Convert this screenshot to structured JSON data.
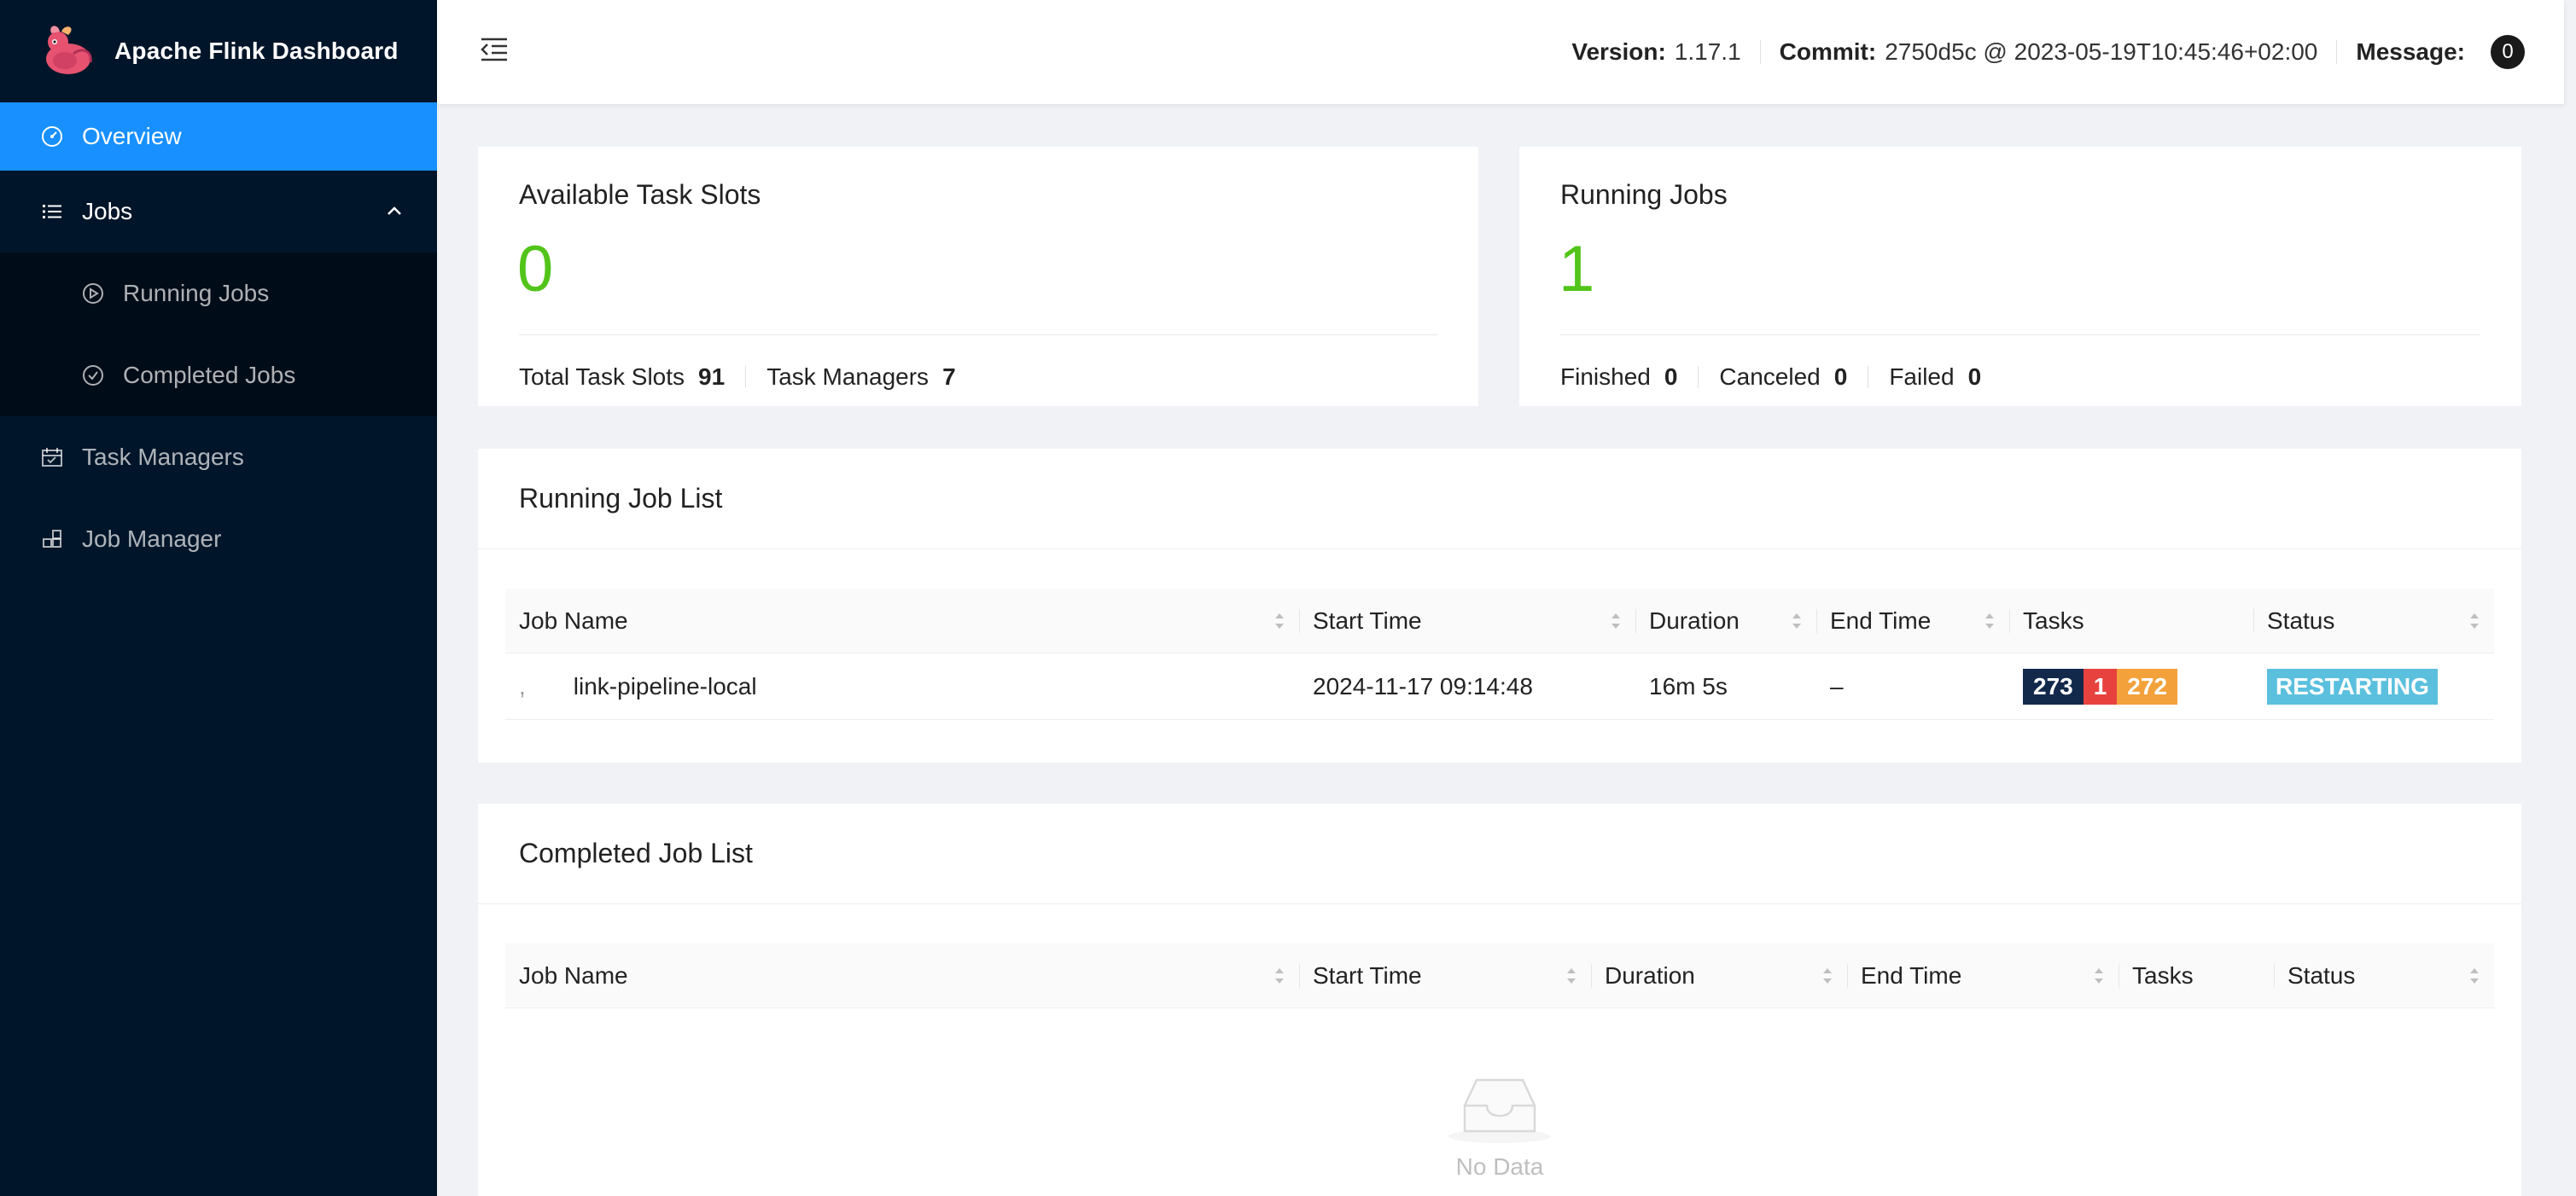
{
  "app": {
    "title": "Apache Flink Dashboard"
  },
  "sidebar": {
    "items": [
      {
        "label": "Overview",
        "icon": "dashboard-icon",
        "active": true
      },
      {
        "label": "Jobs",
        "icon": "list-icon",
        "expanded": true,
        "children": [
          {
            "label": "Running Jobs",
            "icon": "play-circle-icon"
          },
          {
            "label": "Completed Jobs",
            "icon": "check-circle-icon"
          }
        ]
      },
      {
        "label": "Task Managers",
        "icon": "schedule-icon"
      },
      {
        "label": "Job Manager",
        "icon": "cluster-icon"
      }
    ]
  },
  "header": {
    "version_label": "Version:",
    "version": "1.17.1",
    "commit_label": "Commit:",
    "commit": "2750d5c @ 2023-05-19T10:45:46+02:00",
    "message_label": "Message:",
    "message_count": "0"
  },
  "slots_card": {
    "title": "Available Task Slots",
    "value": "0",
    "total_label": "Total Task Slots",
    "total": "91",
    "tm_label": "Task Managers",
    "tm": "7"
  },
  "jobs_card": {
    "title": "Running Jobs",
    "value": "1",
    "finished_label": "Finished",
    "finished": "0",
    "canceled_label": "Canceled",
    "canceled": "0",
    "failed_label": "Failed",
    "failed": "0"
  },
  "running_list": {
    "title": "Running Job List",
    "columns": [
      "Job Name",
      "Start Time",
      "Duration",
      "End Time",
      "Tasks",
      "Status"
    ],
    "rows": [
      {
        "job_name": "link-pipeline-local",
        "start_time": "2024-11-17 09:14:48",
        "duration": "16m 5s",
        "end_time": "–",
        "tasks": {
          "total": "273",
          "failed": "1",
          "other": "272"
        },
        "status": "RESTARTING"
      }
    ]
  },
  "completed_list": {
    "title": "Completed Job List",
    "columns": [
      "Job Name",
      "Start Time",
      "Duration",
      "End Time",
      "Tasks",
      "Status"
    ],
    "empty_text": "No Data"
  },
  "colors": {
    "sidebar_bg": "#001529",
    "active": "#1890ff",
    "green": "#52c41a",
    "task_total": "#13294b",
    "task_failed": "#e8423f",
    "task_other": "#f3a13b",
    "restarting": "#5bc0de"
  }
}
